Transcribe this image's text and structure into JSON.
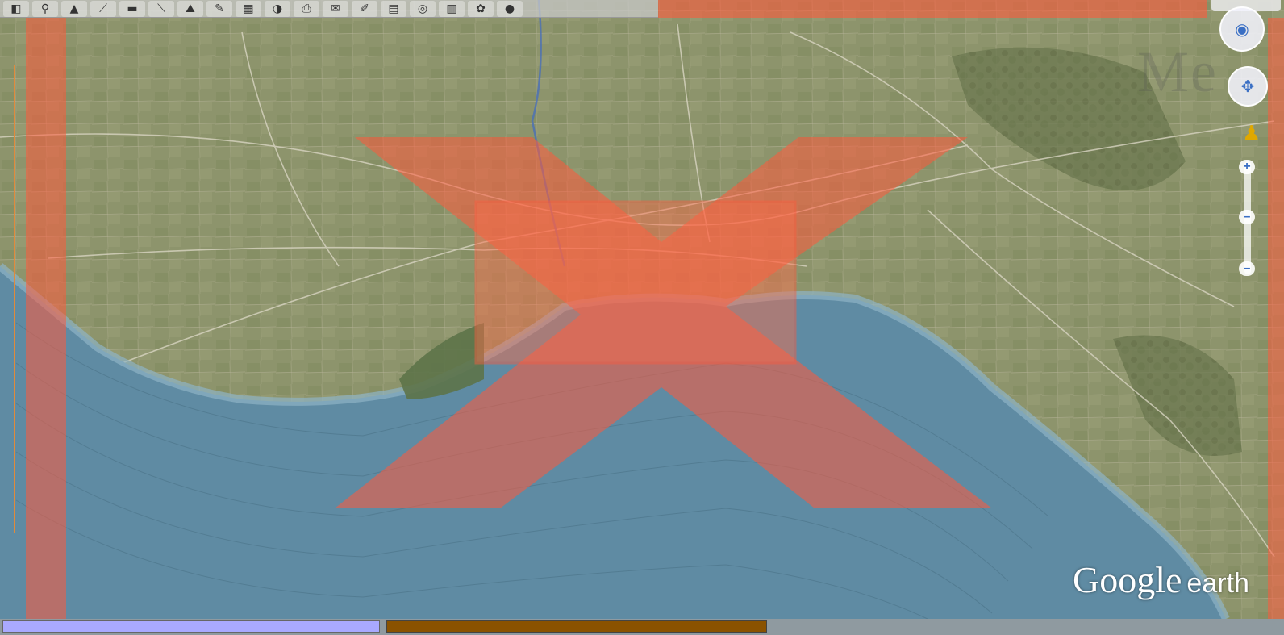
{
  "toolbar": {
    "buttons": [
      {
        "name": "sidebar-toggle-icon",
        "glyph": "◧"
      },
      {
        "name": "placemark-icon",
        "glyph": "⚲"
      },
      {
        "name": "polygon-icon",
        "glyph": "▲"
      },
      {
        "name": "path-icon",
        "glyph": "⟋"
      },
      {
        "name": "overlay-icon",
        "glyph": "▬"
      },
      {
        "name": "ruler-icon",
        "glyph": "⟍"
      },
      {
        "name": "tour-icon",
        "glyph": "⛰"
      },
      {
        "name": "record-tour-icon",
        "glyph": "✎"
      },
      {
        "name": "sun-icon",
        "glyph": "▦"
      },
      {
        "name": "historical-imagery-icon",
        "glyph": "◑"
      },
      {
        "name": "print-icon",
        "glyph": "⎙"
      },
      {
        "name": "email-icon",
        "glyph": "✉"
      },
      {
        "name": "save-image-icon",
        "glyph": "✐"
      },
      {
        "name": "map-icon",
        "glyph": "▤"
      },
      {
        "name": "sky-icon",
        "glyph": "◎"
      },
      {
        "name": "planet-icon",
        "glyph": "▥"
      },
      {
        "name": "mars-icon",
        "glyph": "✿"
      },
      {
        "name": "moon-icon",
        "glyph": "●"
      }
    ]
  },
  "navigation": {
    "look_icon": "eye-icon",
    "move_icon": "hand-icon",
    "zoom_in": "+",
    "zoom_mid": "–",
    "zoom_out": "–"
  },
  "watermark": "Me",
  "logo": {
    "google": "Google",
    "earth": "earth"
  },
  "colors": {
    "land": "#8b916a",
    "water": "#5f8ba3",
    "overlay_red": "#ff5a3c",
    "overlay_red_opacity": 0.55,
    "status_seg1": "#a9a9ff",
    "status_seg2": "#8a5200"
  }
}
